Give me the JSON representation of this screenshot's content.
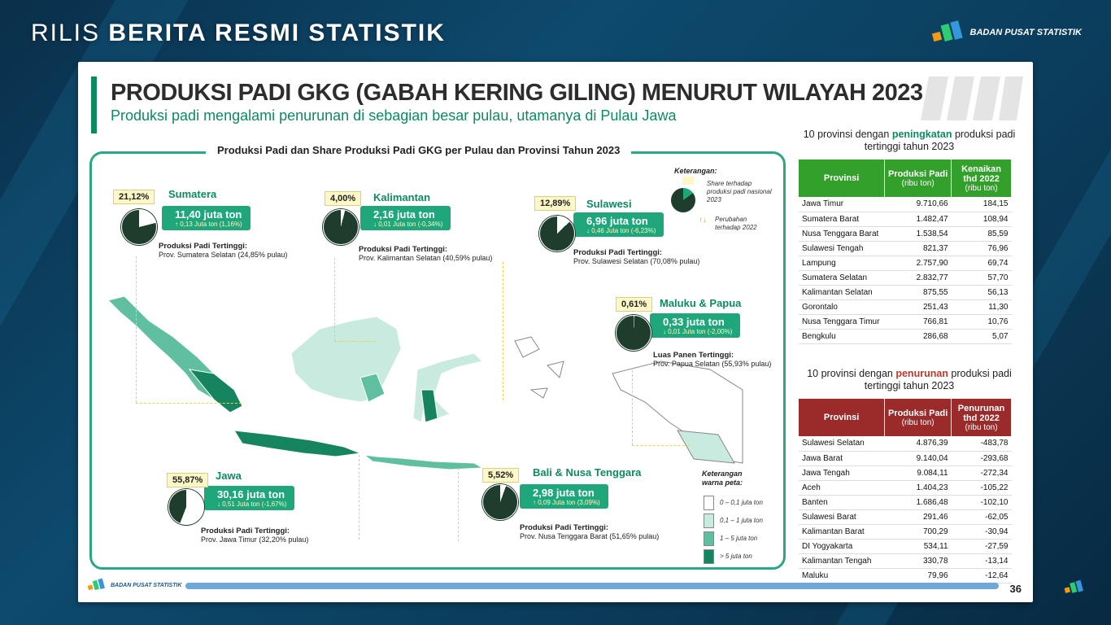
{
  "broadcast": {
    "title_thin": "RILIS",
    "title_bold": "BERITA RESMI STATISTIK",
    "org": "BADAN PUSAT STATISTIK"
  },
  "slide": {
    "title": "PRODUKSI PADI GKG (GABAH KERING GILING) MENURUT WILAYAH 2023",
    "subtitle": "Produksi padi mengalami penurunan di sebagian besar pulau, utamanya di Pulau Jawa",
    "map_title": "Produksi Padi dan Share Produksi Padi GKG per Pulau dan Provinsi Tahun 2023",
    "footer_org": "BADAN PUSAT STATISTIK",
    "page_number": "36"
  },
  "colors": {
    "accent": "#1fa67a",
    "brand_green": "#0e8a61",
    "table_up_header": "#33a02c",
    "table_down_header": "#9b2b2b",
    "pie_dark": "#1f3d2c"
  },
  "islands": [
    {
      "name": "Sumatera",
      "pct": "21,12%",
      "share": 21.12,
      "value": "11,40 juta ton",
      "change": "↑ 0,13 Juta ton (1,16%)",
      "hi_title": "Produksi Padi Tertinggi:",
      "hi_text": "Prov. Sumatera Selatan (24,85% pulau)"
    },
    {
      "name": "Kalimantan",
      "pct": "4,00%",
      "share": 4.0,
      "value": "2,16 juta ton",
      "change": "↓ 0,01 Juta ton (-0,34%)",
      "hi_title": "Produksi Padi Tertinggi:",
      "hi_text": "Prov. Kalimantan Selatan (40,59% pulau)"
    },
    {
      "name": "Sulawesi",
      "pct": "12,89%",
      "share": 12.89,
      "value": "6,96 juta ton",
      "change": "↓ 0,46 Juta ton (-6,23%)",
      "hi_title": "Produksi Padi Tertinggi:",
      "hi_text": "Prov. Sulawesi Selatan (70,08% pulau)"
    },
    {
      "name": "Maluku & Papua",
      "pct": "0,61%",
      "share": 0.61,
      "value": "0,33 juta ton",
      "change": "↓ 0,01 Juta ton (-2,00%)",
      "hi_title": "Luas Panen Tertinggi:",
      "hi_text": "Prov. Papua Selatan (55,93% pulau)"
    },
    {
      "name": "Jawa",
      "pct": "55,87%",
      "share": 55.87,
      "value": "30,16 juta ton",
      "change": "↓ 0,51 Juta ton (-1,67%)",
      "hi_title": "Produksi Padi Tertinggi:",
      "hi_text": "Prov. Jawa Timur (32,20% pulau)"
    },
    {
      "name": "Bali & Nusa Tenggara",
      "pct": "5,52%",
      "share": 5.52,
      "value": "2,98 juta ton",
      "change": "↑ 0,09 Juta ton (3,09%)",
      "hi_title": "Produksi Padi Tertinggi:",
      "hi_text": "Prov. Nusa Tenggara Barat (51,65% pulau)"
    }
  ],
  "legend": {
    "title": "Keterangan:",
    "share_text": "Share terhadap produksi padi nasional 2023",
    "change_text": "Perubahan terhadap 2022",
    "map_title": "Keterangan warna peta:",
    "bins": [
      {
        "label": "0 – 0,1 juta ton",
        "color": "#ffffff"
      },
      {
        "label": "0,1 – 1 juta ton",
        "color": "#c8eadf"
      },
      {
        "label": "1 – 5 juta ton",
        "color": "#5fbfa0"
      },
      {
        "label": "> 5 juta ton",
        "color": "#16845e"
      }
    ]
  },
  "table_up": {
    "title_pre": "10 provinsi dengan",
    "title_kw": "peningkatan",
    "title_post": "produksi padi tertinggi tahun 2023",
    "col1": "Provinsi",
    "col2": "Produksi Padi",
    "col2_unit": "(ribu ton)",
    "col3": "Kenaikan thd 2022",
    "col3_unit": "(ribu ton)",
    "rows": [
      [
        "Jawa Timur",
        "9.710,66",
        "184,15"
      ],
      [
        "Sumatera Barat",
        "1.482,47",
        "108,94"
      ],
      [
        "Nusa Tenggara Barat",
        "1.538,54",
        "85,59"
      ],
      [
        "Sulawesi Tengah",
        "821,37",
        "76,96"
      ],
      [
        "Lampung",
        "2.757,90",
        "69,74"
      ],
      [
        "Sumatera Selatan",
        "2.832,77",
        "57,70"
      ],
      [
        "Kalimantan Selatan",
        "875,55",
        "56,13"
      ],
      [
        "Gorontalo",
        "251,43",
        "11,30"
      ],
      [
        "Nusa Tenggara Timur",
        "766,81",
        "10,76"
      ],
      [
        "Bengkulu",
        "286,68",
        "5,07"
      ]
    ]
  },
  "table_down": {
    "title_pre": "10 provinsi dengan",
    "title_kw": "penurunan",
    "title_post": "produksi padi tertinggi tahun 2023",
    "col1": "Provinsi",
    "col2": "Produksi Padi",
    "col2_unit": "(ribu ton)",
    "col3": "Penurunan thd 2022",
    "col3_unit": "(ribu ton)",
    "rows": [
      [
        "Sulawesi Selatan",
        "4.876,39",
        "-483,78"
      ],
      [
        "Jawa Barat",
        "9.140,04",
        "-293,68"
      ],
      [
        "Jawa Tengah",
        "9.084,11",
        "-272,34"
      ],
      [
        "Aceh",
        "1.404,23",
        "-105,22"
      ],
      [
        "Banten",
        "1.686,48",
        "-102,10"
      ],
      [
        "Sulawesi Barat",
        "291,46",
        "-62,05"
      ],
      [
        "Kalimantan Barat",
        "700,29",
        "-30,94"
      ],
      [
        "DI Yogyakarta",
        "534,11",
        "-27,59"
      ],
      [
        "Kalimantan Tengah",
        "330,78",
        "-13,14"
      ],
      [
        "Maluku",
        "79,96",
        "-12,64"
      ]
    ]
  }
}
